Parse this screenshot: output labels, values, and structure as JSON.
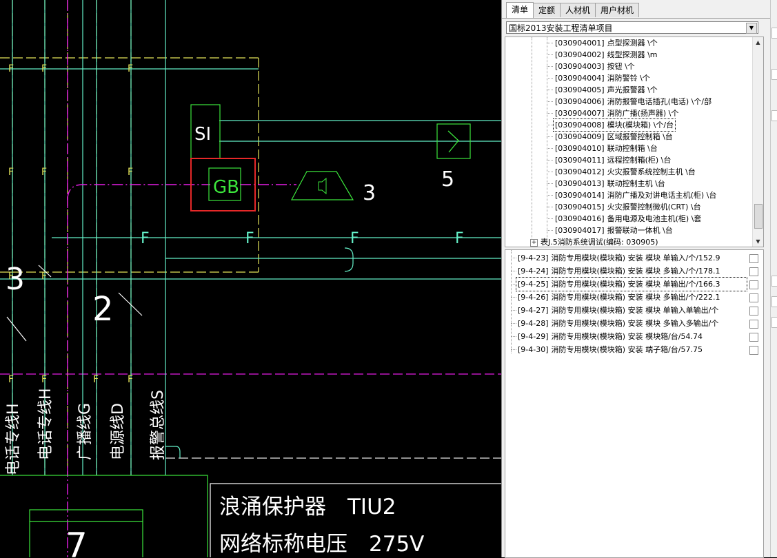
{
  "tabs": [
    "清单",
    "定额",
    "人材机",
    "用户材机"
  ],
  "active_tab": 0,
  "library_select": {
    "value": "国标2013安装工程清单项目"
  },
  "tree": {
    "items": [
      {
        "code": "[030904001]",
        "name": "点型探测器 \\个"
      },
      {
        "code": "[030904002]",
        "name": "线型探测器 \\m"
      },
      {
        "code": "[030904003]",
        "name": "按钮 \\个"
      },
      {
        "code": "[030904004]",
        "name": "消防警铃 \\个"
      },
      {
        "code": "[030904005]",
        "name": "声光报警器 \\个"
      },
      {
        "code": "[030904006]",
        "name": "消防报警电话插孔(电话) \\个/部"
      },
      {
        "code": "[030904007]",
        "name": "消防广播(扬声器) \\个"
      },
      {
        "code": "[030904008]",
        "name": "模块(模块箱) \\个/台"
      },
      {
        "code": "[030904009]",
        "name": "区域报警控制箱 \\台"
      },
      {
        "code": "[030904010]",
        "name": "联动控制箱 \\台"
      },
      {
        "code": "[030904011]",
        "name": "远程控制箱(柜) \\台"
      },
      {
        "code": "[030904012]",
        "name": "火灾报警系统控制主机 \\台"
      },
      {
        "code": "[030904013]",
        "name": "联动控制主机 \\台"
      },
      {
        "code": "[030904014]",
        "name": "消防广播及对讲电话主机(柜) \\台"
      },
      {
        "code": "[030904015]",
        "name": "火灾报警控制微机(CRT) \\台"
      },
      {
        "code": "[030904016]",
        "name": "备用电源及电池主机(柜) \\套"
      },
      {
        "code": "[030904017]",
        "name": "报警联动一体机 \\台"
      }
    ],
    "selected_index": 7,
    "group": {
      "expander": "+",
      "label": "表J.5消防系统调试(编码: 030905)"
    }
  },
  "quota_list": {
    "items": [
      {
        "code": "[9-4-23]",
        "text": "消防专用模块(模块箱) 安装 模块 单输入/个/152.9"
      },
      {
        "code": "[9-4-24]",
        "text": "消防专用模块(模块箱) 安装 模块 多输入/个/178.1"
      },
      {
        "code": "[9-4-25]",
        "text": "消防专用模块(模块箱) 安装 模块 单输出/个/166.3"
      },
      {
        "code": "[9-4-26]",
        "text": "消防专用模块(模块箱) 安装 模块 多输出/个/222.1"
      },
      {
        "code": "[9-4-27]",
        "text": "消防专用模块(模块箱) 安装 模块 单输入单输出/个"
      },
      {
        "code": "[9-4-28]",
        "text": "消防专用模块(模块箱) 安装 模块 多输入多输出/个"
      },
      {
        "code": "[9-4-29]",
        "text": "消防专用模块(模块箱) 安装 模块箱/台/54.74"
      },
      {
        "code": "[9-4-30]",
        "text": "消防专用模块(模块箱) 安装 端子箱/台/57.75"
      }
    ],
    "selected_index": 2
  },
  "drawing": {
    "symbols": {
      "si": "SI",
      "gb": "GB",
      "speaker_no": "3",
      "module_no": "5",
      "left_no": "2",
      "left_big": "3",
      "bottom_no": "7"
    },
    "f_label": "F",
    "cable_labels": [
      "电话专线H",
      "电话专线H",
      "广播线G",
      "电源线D",
      "报警总线S"
    ],
    "surge_line1": "浪涌保护器　TIU2",
    "surge_line2": "网络标称电压　275V"
  },
  "colors": {
    "cad_bg": "#000000",
    "yellow": "#e6e65a",
    "magenta": "#e61ee6",
    "green": "#3ce63c",
    "cyan": "#64f0c8",
    "white": "#ffffff",
    "highlight": "#e62828"
  }
}
